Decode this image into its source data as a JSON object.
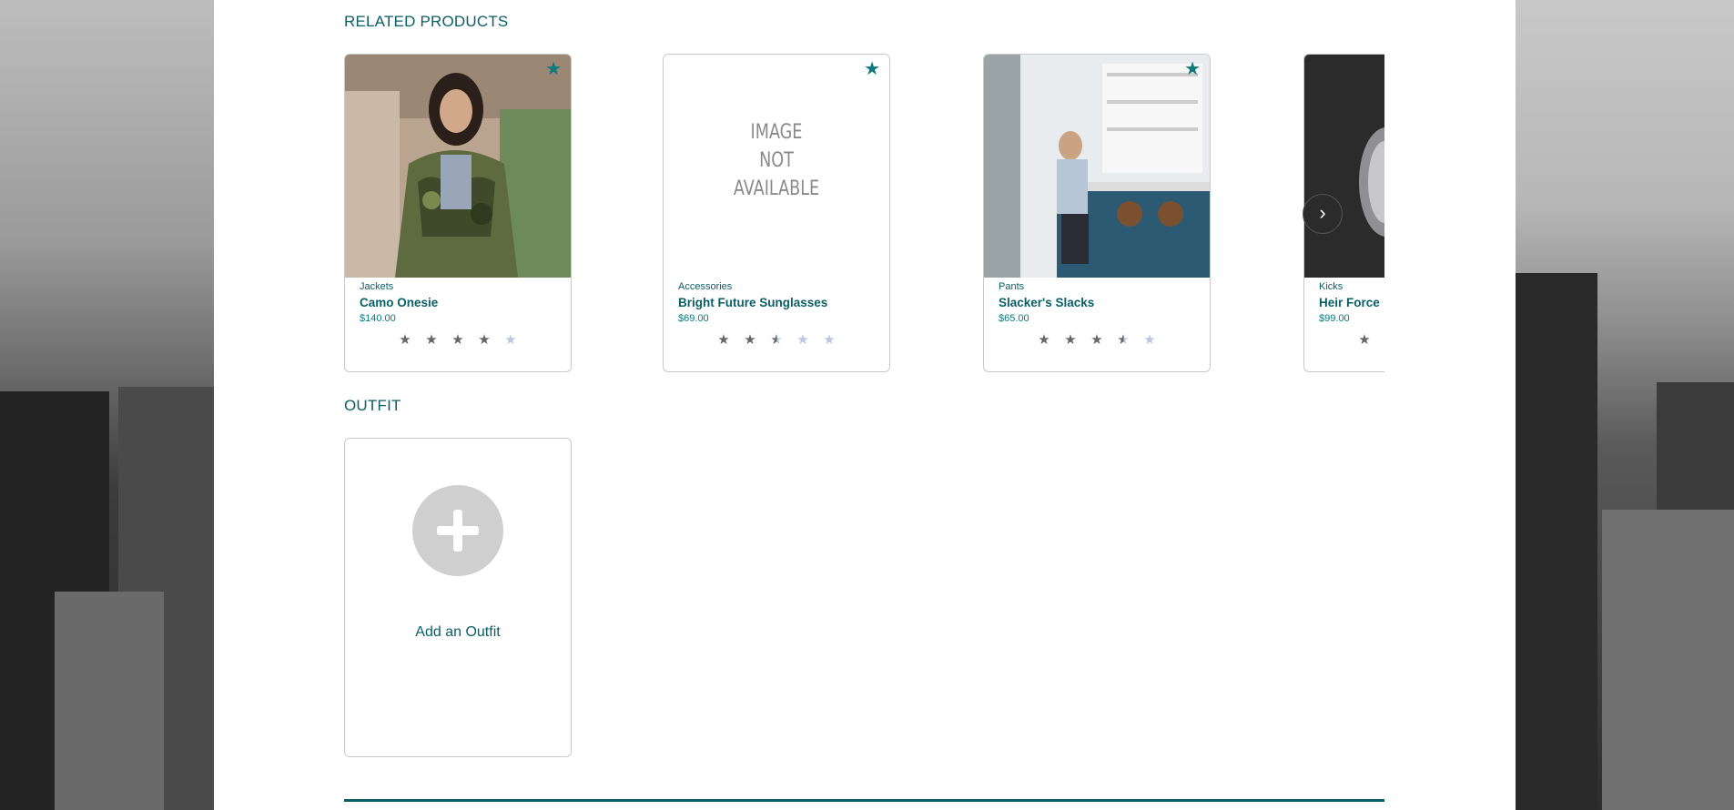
{
  "related": {
    "title": "RELATED PRODUCTS",
    "next_label": "›",
    "products": [
      {
        "category": "Jackets",
        "name": "Camo Onesie",
        "price": "$140.00",
        "rating": 4.0,
        "favorited": true
      },
      {
        "category": "Accessories",
        "name": "Bright Future Sunglasses",
        "price": "$69.00",
        "rating": 2.5,
        "favorited": true,
        "image_text": [
          "IMAGE",
          "NOT",
          "AVAILABLE"
        ]
      },
      {
        "category": "Pants",
        "name": "Slacker's Slacks",
        "price": "$65.00",
        "rating": 3.5,
        "favorited": true
      },
      {
        "category": "Kicks",
        "name": "Heir Force",
        "price": "$99.00",
        "rating": 1.0,
        "favorited": false
      }
    ]
  },
  "outfit": {
    "title": "OUTFIT",
    "add_label": "Add an Outfit"
  },
  "colors": {
    "accent": "#0a5e66",
    "star_favorite": "#0a7a7c",
    "star_filled": "#666666",
    "star_empty": "#b9c8de"
  },
  "icons": {
    "favorite": "star-icon",
    "rating": "star-icon",
    "next": "chevron-right-icon",
    "add": "plus-icon"
  }
}
